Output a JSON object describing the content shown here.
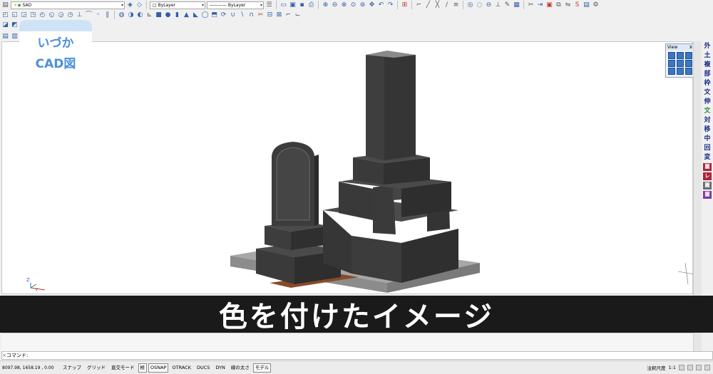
{
  "toolbar_top": {
    "layer_value": "SAO",
    "color_value": "ByLayer",
    "linetype_value": "ByLayer",
    "icons": [
      "new-icon",
      "open-icon",
      "save-icon",
      "print-icon",
      "zoom-icon",
      "pan-icon",
      "undo-icon",
      "redo-icon",
      "line-icon",
      "arc-icon",
      "circle-icon",
      "erase-icon",
      "copy-icon",
      "mirror-icon"
    ]
  },
  "logo": {
    "line1": "いづか",
    "line2": "CAD図"
  },
  "view_palette": {
    "title": "View",
    "close": "x"
  },
  "vertical_toolbar": [
    "外",
    "土",
    "複",
    "部",
    "枠",
    "文",
    "伸",
    "文",
    "対",
    "移",
    "中",
    "回",
    "変",
    "圖",
    "レ",
    "圖",
    "圖"
  ],
  "caption": "色を付けたイメージ",
  "ucs": {
    "z": "Z",
    "y": "Y"
  },
  "command_line": {
    "prompt": "コマンド:"
  },
  "status_bar": {
    "coords": "8097.98,  1658.19 , 0.00",
    "buttons": [
      {
        "label": "スナップ",
        "on": false
      },
      {
        "label": "グリッド",
        "on": false
      },
      {
        "label": "直交モード",
        "on": false
      },
      {
        "label": "極",
        "on": true
      },
      {
        "label": "OSNAP",
        "on": true
      },
      {
        "label": "OTRACK",
        "on": false
      },
      {
        "label": "DUCS",
        "on": false
      },
      {
        "label": "DYN",
        "on": false
      },
      {
        "label": "線の太さ",
        "on": false
      },
      {
        "label": "モデル",
        "on": true
      }
    ],
    "annotation_scale_label": "注釈尺度",
    "annotation_scale_value": "1:1"
  },
  "colors": {
    "stone_dark": "#3b3b3b",
    "stone_base": "#9a9a9a",
    "brick": "#8a4a2a",
    "caption_bg": "#1a1a1a",
    "logo_text": "#4a90d9"
  }
}
